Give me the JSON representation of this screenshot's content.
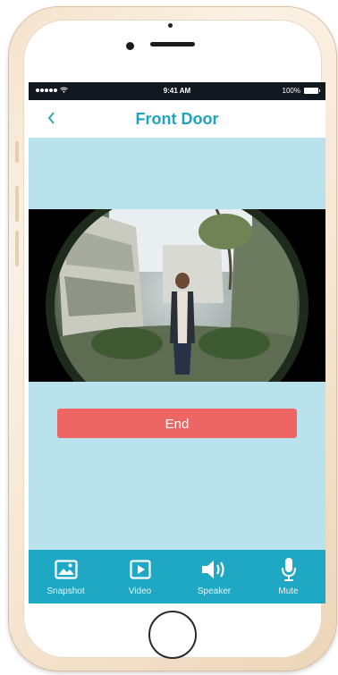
{
  "status_bar": {
    "carrier_signal": "•••••",
    "time": "9:41 AM",
    "battery": "100%"
  },
  "nav": {
    "back_icon": "chevron-left-icon",
    "title": "Front Door"
  },
  "video": {
    "description": "fisheye-live-view"
  },
  "end_button": {
    "label": "End",
    "color": "#ee6664"
  },
  "toolbar": {
    "items": [
      {
        "label": "Snapshot",
        "icon": "image-icon"
      },
      {
        "label": "Video",
        "icon": "video-play-icon"
      },
      {
        "label": "Speaker",
        "icon": "speaker-icon"
      },
      {
        "label": "Mute",
        "icon": "microphone-icon"
      }
    ]
  },
  "colors": {
    "accent": "#1fa8c3",
    "screen_bg": "#b9e2ec",
    "status_bar_bg": "#121820"
  }
}
